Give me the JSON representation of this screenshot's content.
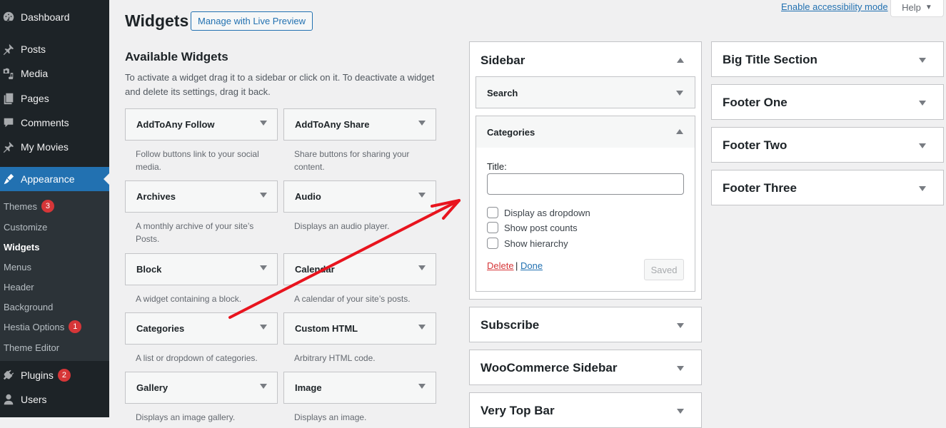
{
  "admin_menu": {
    "items": [
      {
        "label": "Dashboard",
        "icon": "dashboard-icon"
      },
      {
        "label": "Posts",
        "icon": "pin-icon"
      },
      {
        "label": "Media",
        "icon": "media-icon"
      },
      {
        "label": "Pages",
        "icon": "pages-icon"
      },
      {
        "label": "Comments",
        "icon": "comment-icon"
      },
      {
        "label": "My Movies",
        "icon": "pin-icon"
      },
      {
        "label": "Appearance",
        "icon": "paintbrush-icon",
        "current": true
      },
      {
        "label": "Plugins",
        "icon": "plugin-icon",
        "badge": "2"
      },
      {
        "label": "Users",
        "icon": "user-icon"
      }
    ],
    "appearance_submenu": [
      {
        "label": "Themes",
        "badge": "3"
      },
      {
        "label": "Customize"
      },
      {
        "label": "Widgets",
        "current": true
      },
      {
        "label": "Menus"
      },
      {
        "label": "Header"
      },
      {
        "label": "Background"
      },
      {
        "label": "Hestia Options",
        "badge": "1"
      },
      {
        "label": "Theme Editor"
      }
    ]
  },
  "header": {
    "title": "Widgets",
    "live_preview_button": "Manage with Live Preview",
    "accessibility_link": "Enable accessibility mode",
    "help_button": "Help",
    "help_arrow": "▼"
  },
  "available": {
    "title": "Available Widgets",
    "description": "To activate a widget drag it to a sidebar or click on it. To deactivate a widget and delete its settings, drag it back.",
    "widgets": [
      {
        "name": "AddToAny Follow",
        "description": "Follow buttons link to your social media."
      },
      {
        "name": "AddToAny Share",
        "description": "Share buttons for sharing your content."
      },
      {
        "name": "Archives",
        "description": "A monthly archive of your site’s Posts."
      },
      {
        "name": "Audio",
        "description": "Displays an audio player."
      },
      {
        "name": "Block",
        "description": "A widget containing a block."
      },
      {
        "name": "Calendar",
        "description": "A calendar of your site’s posts."
      },
      {
        "name": "Categories",
        "description": "A list or dropdown of categories."
      },
      {
        "name": "Custom HTML",
        "description": "Arbitrary HTML code."
      },
      {
        "name": "Gallery",
        "description": "Displays an image gallery."
      },
      {
        "name": "Image",
        "description": "Displays an image."
      }
    ]
  },
  "sidebar_area": {
    "title": "Sidebar",
    "widgets": [
      {
        "name": "Search",
        "expanded": false
      },
      {
        "name": "Categories",
        "expanded": true
      }
    ],
    "categories_form": {
      "title_label": "Title:",
      "title_value": "",
      "checkboxes": [
        {
          "label": "Display as dropdown",
          "checked": false
        },
        {
          "label": "Show post counts",
          "checked": false
        },
        {
          "label": "Show hierarchy",
          "checked": false
        }
      ],
      "delete_label": "Delete",
      "separator": "|",
      "done_label": "Done",
      "saved_label": "Saved"
    }
  },
  "middle_areas": [
    "Subscribe",
    "WooCommerce Sidebar",
    "Very Top Bar"
  ],
  "right_areas": [
    "Big Title Section",
    "Footer One",
    "Footer Two",
    "Footer Three"
  ],
  "annotation": {
    "type": "red-arrow",
    "color": "#e8141e",
    "from": "Categories widget",
    "to": "Sidebar area"
  }
}
